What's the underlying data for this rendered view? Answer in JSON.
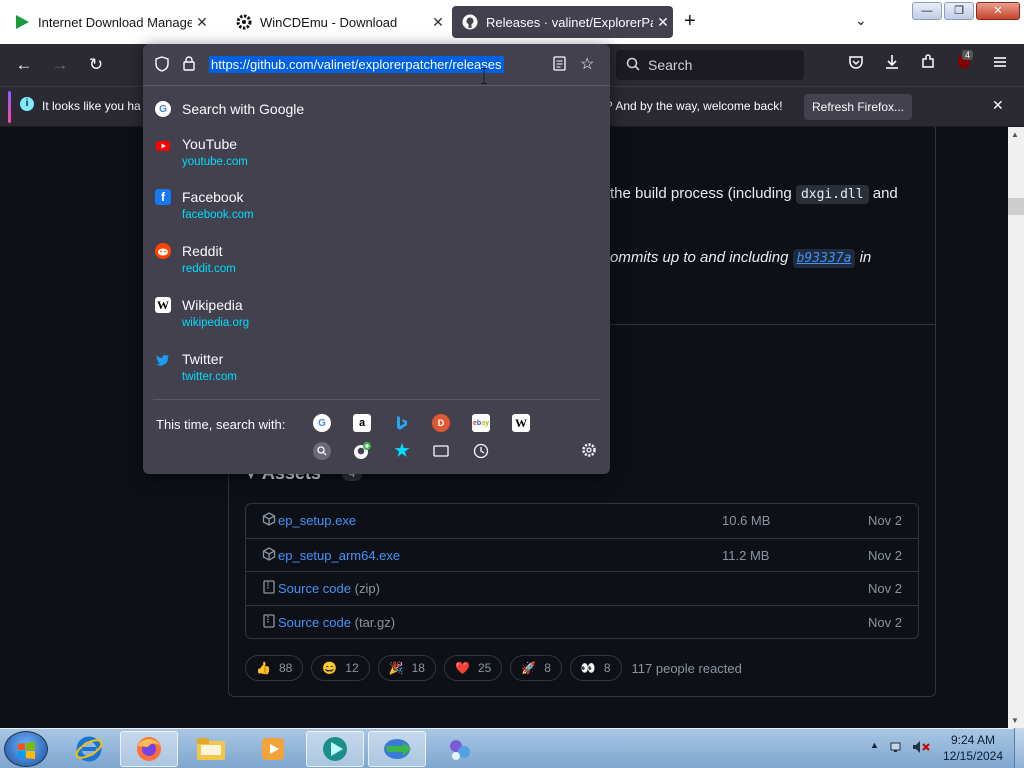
{
  "tabs": [
    {
      "title": "Internet Download Manager is ...",
      "close": "✕",
      "icon": "idm-play-icon"
    },
    {
      "title": "WinCDEmu - Download",
      "close": "✕",
      "icon": "gear-icon"
    },
    {
      "title": "Releases · valinet/ExplorerPatch...",
      "close": "✕",
      "icon": "github-icon"
    }
  ],
  "tabstrip": {
    "new_tab": "+",
    "list_tabs": "⌄"
  },
  "window": {
    "minimize": "—",
    "maximize": "❐",
    "close": "✕"
  },
  "nav": {
    "back": "←",
    "forward": "→",
    "reload": "↻",
    "search_placeholder": "Search",
    "ubo_badge": "4"
  },
  "urlbar": {
    "url": "https://github.com/valinet/explorerpatcher/releases"
  },
  "suggestions": [
    {
      "title": "Search with Google",
      "url": "",
      "icon": "google-icon"
    },
    {
      "title": "YouTube",
      "url": "youtube.com",
      "icon": "youtube-icon"
    },
    {
      "title": "Facebook",
      "url": "facebook.com",
      "icon": "facebook-icon"
    },
    {
      "title": "Reddit",
      "url": "reddit.com",
      "icon": "reddit-icon"
    },
    {
      "title": "Wikipedia",
      "url": "wikipedia.org",
      "icon": "wikipedia-icon"
    },
    {
      "title": "Twitter",
      "url": "twitter.com",
      "icon": "twitter-icon"
    }
  ],
  "search_engines": {
    "label": "This time, search with:",
    "engines": [
      "google-icon",
      "amazon-icon",
      "bing-icon",
      "duckduckgo-icon",
      "ebay-icon",
      "wikipedia-icon"
    ],
    "modes": [
      "search-icon",
      "github-add-icon",
      "bookmarks-star-icon",
      "tabs-icon",
      "history-icon"
    ]
  },
  "notification": {
    "text_left": "It looks like you ha",
    "text_right": "? And by the way, welcome back!",
    "button": "Refresh Firefox..."
  },
  "page": {
    "line1_prefix": "the build process (including",
    "line1_code": "dxgi.dll",
    "line1_suffix": "and",
    "line2_prefix": "ommits up to and including",
    "line2_commit": "b93337a",
    "line2_suffix": "in",
    "assets_title": "Assets",
    "assets_count": "4",
    "assets": [
      {
        "name": "ep_setup.exe",
        "ext": "",
        "size": "10.6 MB",
        "date": "Nov 2",
        "icon": "package-icon"
      },
      {
        "name": "ep_setup_arm64.exe",
        "ext": "",
        "size": "11.2 MB",
        "date": "Nov 2",
        "icon": "package-icon"
      },
      {
        "name": "Source code",
        "ext": "(zip)",
        "size": "",
        "date": "Nov 2",
        "icon": "file-zip-icon"
      },
      {
        "name": "Source code",
        "ext": "(tar.gz)",
        "size": "",
        "date": "Nov 2",
        "icon": "file-zip-icon"
      }
    ],
    "reactions": [
      {
        "emoji": "👍",
        "count": "88"
      },
      {
        "emoji": "😄",
        "count": "12"
      },
      {
        "emoji": "🎉",
        "count": "18"
      },
      {
        "emoji": "❤️",
        "count": "25"
      },
      {
        "emoji": "🚀",
        "count": "8"
      },
      {
        "emoji": "👀",
        "count": "8"
      }
    ],
    "reactions_total": "117 people reacted"
  },
  "taskbar": {
    "time": "9:24 AM",
    "date": "12/15/2024",
    "apps": [
      "internet-explorer-icon",
      "firefox-icon",
      "explorer-folder-icon",
      "media-player-icon",
      "wincdemu-icon",
      "idm-icon",
      "app-icon"
    ]
  }
}
